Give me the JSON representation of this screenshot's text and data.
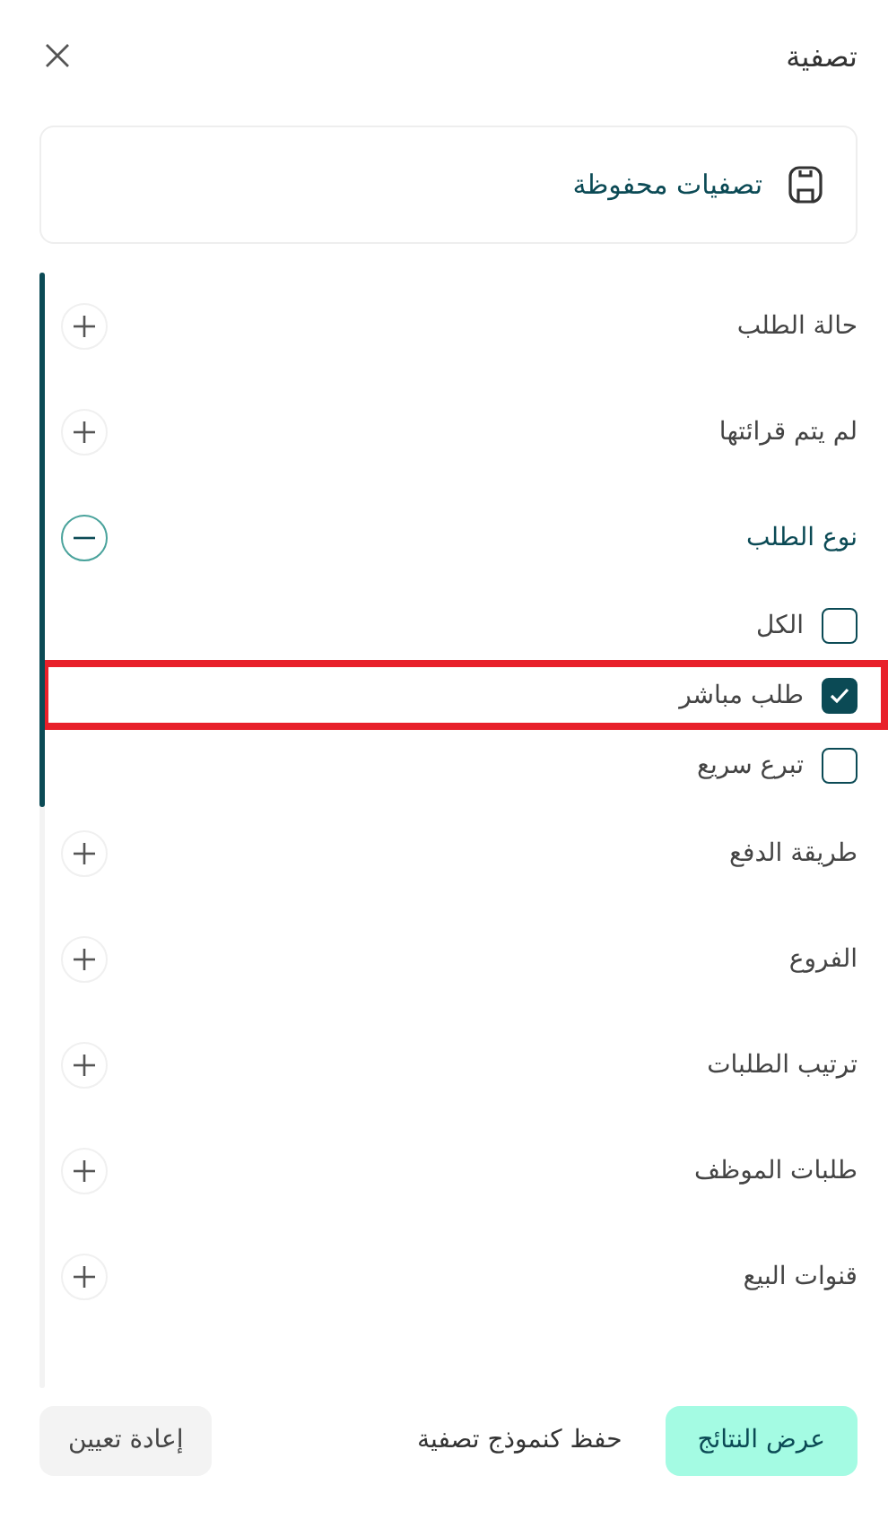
{
  "header": {
    "title": "تصفية"
  },
  "saved_filters": {
    "label": "تصفيات محفوظة"
  },
  "groups": [
    {
      "label": "حالة الطلب",
      "expanded": false
    },
    {
      "label": "لم يتم قرائتها",
      "expanded": false
    },
    {
      "label": "نوع الطلب",
      "expanded": true,
      "options": [
        {
          "label": "الكل",
          "checked": false,
          "highlighted": false
        },
        {
          "label": "طلب مباشر",
          "checked": true,
          "highlighted": true
        },
        {
          "label": "تبرع سريع",
          "checked": false,
          "highlighted": false
        }
      ]
    },
    {
      "label": "طريقة الدفع",
      "expanded": false
    },
    {
      "label": "الفروع",
      "expanded": false
    },
    {
      "label": "ترتيب الطلبات",
      "expanded": false
    },
    {
      "label": "طلبات الموظف",
      "expanded": false
    },
    {
      "label": "قنوات البيع",
      "expanded": false
    }
  ],
  "footer": {
    "show_results": "عرض النتائج",
    "save_as_template": "حفظ كنموذج تصفية",
    "reset": "إعادة تعيين"
  }
}
